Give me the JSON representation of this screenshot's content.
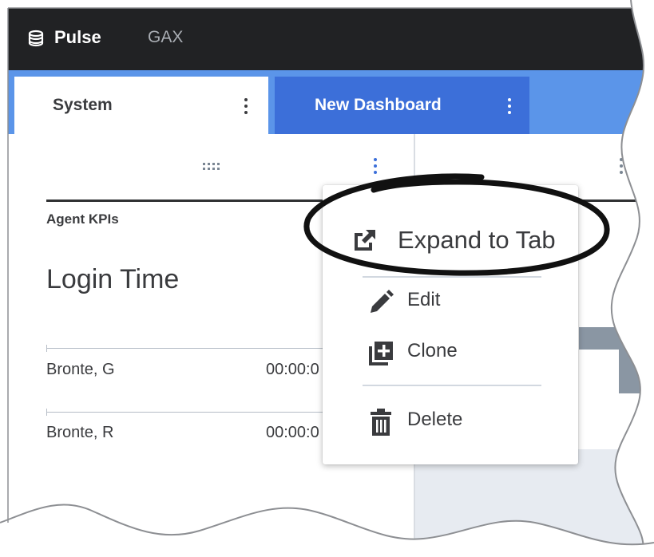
{
  "app": {
    "name": "Pulse",
    "nav_item": "GAX",
    "icon": "database-stack-icon"
  },
  "tabs": [
    {
      "label": "System",
      "active": false
    },
    {
      "label": "New Dashboard",
      "active": true
    }
  ],
  "widget": {
    "category": "Agent KPIs",
    "title": "Login Time",
    "rows": [
      {
        "name": "Bronte, G",
        "value": "00:00:0"
      },
      {
        "name": "Bronte, R",
        "value": "00:00:0"
      }
    ]
  },
  "menu": {
    "items": [
      {
        "label": "Expand to Tab",
        "icon": "open-in-new-tab-icon"
      },
      {
        "label": "Edit",
        "icon": "pencil-icon"
      },
      {
        "label": "Clone",
        "icon": "add-copy-icon"
      },
      {
        "label": "Delete",
        "icon": "trash-icon"
      }
    ]
  },
  "colors": {
    "topbar": "#212224",
    "tabstrip": "#5b95e9",
    "active_tab": "#3c6fd9",
    "text": "#3a3b3e",
    "add_icon": "#8a96a3"
  }
}
